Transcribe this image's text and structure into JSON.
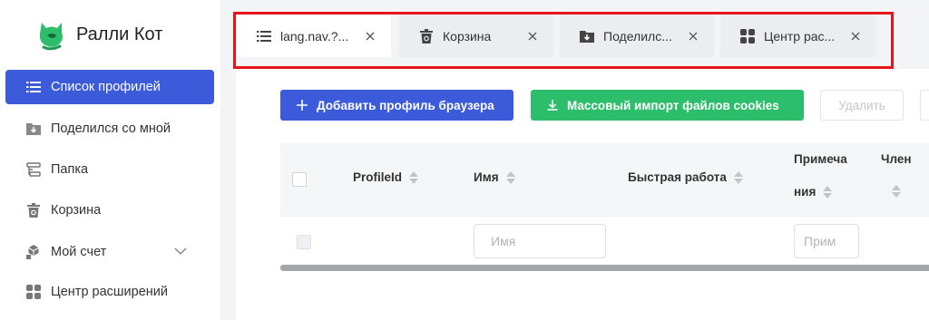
{
  "app": {
    "name": "Ралли Кот",
    "brand_color": "#3b5bdb",
    "logo_color": "#2dbe6c"
  },
  "sidebar": {
    "items": [
      {
        "label": "Список профилей",
        "icon": "list-icon",
        "active": true
      },
      {
        "label": "Поделился со мной",
        "icon": "folder-download-icon"
      },
      {
        "label": "Папка",
        "icon": "folder-tree-icon"
      },
      {
        "label": "Корзина",
        "icon": "trash-icon"
      },
      {
        "label": "Мой счет",
        "icon": "cubes-icon",
        "expandable": true
      },
      {
        "label": "Центр расширений",
        "icon": "grid-icon"
      }
    ]
  },
  "tabs": [
    {
      "label": "lang.nav.?...",
      "icon": "list-icon",
      "active": true
    },
    {
      "label": "Корзина",
      "icon": "trash-icon"
    },
    {
      "label": "Поделилс...",
      "icon": "folder-download-icon"
    },
    {
      "label": "Центр рас...",
      "icon": "grid-icon"
    }
  ],
  "toolbar": {
    "add_label": "Добавить профиль браузера",
    "import_label": "Массовый импорт файлов cookies",
    "delete_label": "Удалить",
    "add_color": "#3b5bdb",
    "import_color": "#2dbe6c"
  },
  "table": {
    "columns": [
      {
        "label": "ProfileId",
        "sortable": true
      },
      {
        "label": "Имя",
        "sortable": true
      },
      {
        "label": "Быстрая работа",
        "sortable": true
      },
      {
        "label_line1": "Примеча",
        "label_line2": "ния",
        "sortable": true
      },
      {
        "label": "Член",
        "sortable": true
      }
    ],
    "filters": {
      "name_placeholder": "Имя",
      "note_placeholder": "Прим"
    }
  },
  "highlight_color": "#e8141c"
}
